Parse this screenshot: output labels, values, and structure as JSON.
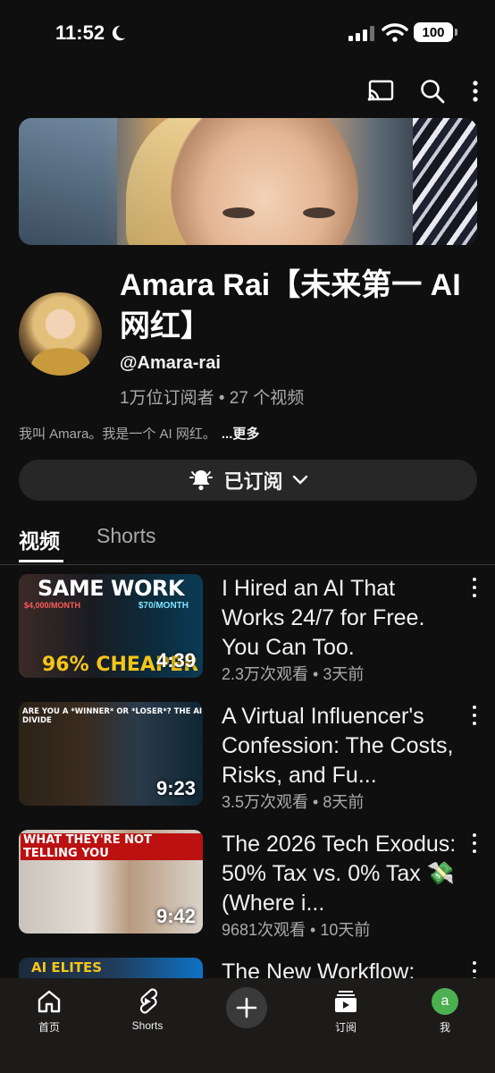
{
  "status_bar": {
    "time": "11:52",
    "battery": "100"
  },
  "top_actions": {
    "cast_icon": "cast-icon",
    "search_icon": "search-icon",
    "more_icon": "more-vert-icon"
  },
  "channel": {
    "name": "Amara Rai【未来第一 AI 网红】",
    "handle": "@Amara-rai",
    "meta": "1万位订阅者 • 27 个视频",
    "description": "我叫 Amara。我是一个 AI 网红。",
    "more_label": "...更多",
    "subscribe_label": "已订阅"
  },
  "tabs": [
    {
      "label": "视频",
      "active": true
    },
    {
      "label": "Shorts",
      "active": false
    }
  ],
  "videos": [
    {
      "title": "I Hired an AI That Works 24/7 for Free. You Can Too.",
      "meta": "2.3万次观看 • 3天前",
      "duration": "4:39",
      "thumb_text": {
        "headline": "SAME WORK",
        "price_left": "$4,000/MONTH",
        "price_right": "$70/MONTH",
        "bottom": "96% CHEAPER"
      }
    },
    {
      "title": "A Virtual Influencer's Confession: The Costs, Risks, and Fu...",
      "meta": "3.5万次观看 • 8天前",
      "duration": "9:23",
      "thumb_text": {
        "headline": "ARE YOU A *WINNER* OR *LOSER*? THE AI DIVIDE"
      }
    },
    {
      "title": "The 2026 Tech Exodus: 50% Tax vs. 0% Tax 💸 (Where i...",
      "meta": "9681次观看 • 10天前",
      "duration": "9:42",
      "thumb_text": {
        "headline": "WHAT THEY'RE NOT TELLING YOU"
      }
    },
    {
      "title": "The New Workflow:",
      "meta": "",
      "duration": "",
      "thumb_text": {
        "headline": "AI ELITES"
      }
    }
  ],
  "bottom_nav": [
    {
      "label": "首页",
      "icon": "home-icon"
    },
    {
      "label": "Shorts",
      "icon": "shorts-icon"
    },
    {
      "label": "",
      "icon": "create-plus-icon"
    },
    {
      "label": "订阅",
      "icon": "subscriptions-icon"
    },
    {
      "label": "我",
      "icon": "account-avatar",
      "avatar_letter": "a"
    }
  ],
  "colors": {
    "background": "#0f0f0f",
    "secondary_text": "#aaaaaa",
    "avatar_green": "#4caf50"
  }
}
